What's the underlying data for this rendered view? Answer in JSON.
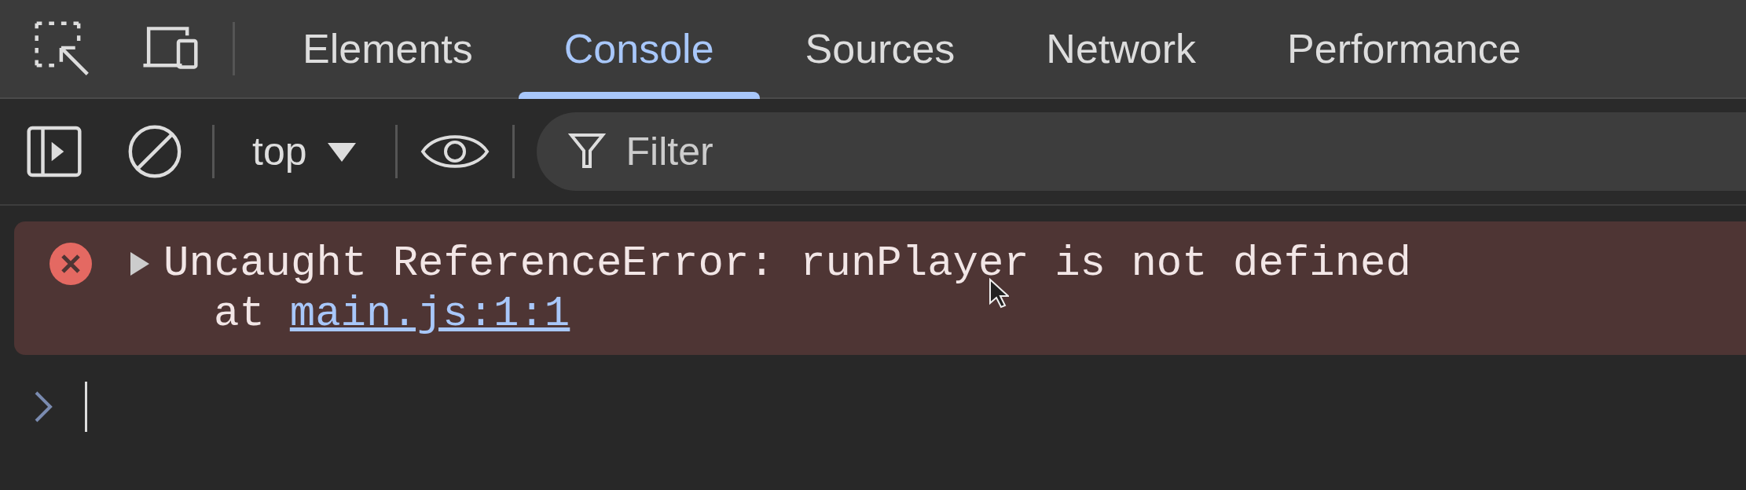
{
  "panel_tabs": [
    {
      "label": "Elements",
      "selected": false
    },
    {
      "label": "Console",
      "selected": true
    },
    {
      "label": "Sources",
      "selected": false
    },
    {
      "label": "Network",
      "selected": false
    },
    {
      "label": "Performance",
      "selected": false
    }
  ],
  "console_toolbar": {
    "context": "top",
    "filter": {
      "placeholder": "Filter"
    }
  },
  "messages": [
    {
      "kind": "error",
      "expanded": false,
      "text": "Uncaught ReferenceError: runPlayer is not defined",
      "location_prefix": "at",
      "location_link": "main.js:1:1"
    }
  ]
}
